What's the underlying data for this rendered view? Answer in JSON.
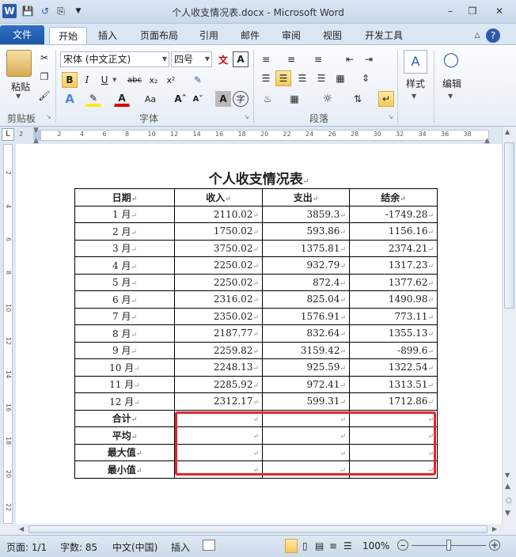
{
  "window": {
    "title": "个人收支情况表.docx - Microsoft Word"
  },
  "tabs": [
    {
      "label": "文件"
    },
    {
      "label": "开始"
    },
    {
      "label": "插入"
    },
    {
      "label": "页面布局"
    },
    {
      "label": "引用"
    },
    {
      "label": "邮件"
    },
    {
      "label": "审阅"
    },
    {
      "label": "视图"
    },
    {
      "label": "开发工具"
    }
  ],
  "ribbon": {
    "clipboard": {
      "label": "剪贴板",
      "paste": "粘贴"
    },
    "font": {
      "label": "字体",
      "font_name": "宋体 (中文正文)",
      "font_size": "四号"
    },
    "paragraph": {
      "label": "段落"
    },
    "styles": {
      "label": "样式"
    },
    "editing": {
      "label": "编辑"
    }
  },
  "ruler": {
    "ticks": [
      "2",
      "2",
      "4",
      "6",
      "8",
      "10",
      "12",
      "14",
      "16",
      "18",
      "20",
      "22",
      "24",
      "26",
      "28",
      "30",
      "32",
      "34",
      "36",
      "38"
    ]
  },
  "vruler": {
    "ticks": [
      "2",
      "4",
      "6",
      "8",
      "10",
      "12",
      "14",
      "16",
      "18",
      "20",
      "22"
    ]
  },
  "document": {
    "title": "个人收支情况表",
    "table": {
      "headers": [
        "日期",
        "收入",
        "支出",
        "结余"
      ],
      "rows": [
        [
          "1 月",
          "2110.02",
          "3859.3",
          "-1749.28"
        ],
        [
          "2 月",
          "1750.02",
          "593.86",
          "1156.16"
        ],
        [
          "3 月",
          "3750.02",
          "1375.81",
          "2374.21"
        ],
        [
          "4 月",
          "2250.02",
          "932.79",
          "1317.23"
        ],
        [
          "5 月",
          "2250.02",
          "872.4",
          "1377.62"
        ],
        [
          "6 月",
          "2316.02",
          "825.04",
          "1490.98"
        ],
        [
          "7 月",
          "2350.02",
          "1576.91",
          "773.11"
        ],
        [
          "8 月",
          "2187.77",
          "832.64",
          "1355.13"
        ],
        [
          "9 月",
          "2259.82",
          "3159.42",
          "-899.6"
        ],
        [
          "10 月",
          "2248.13",
          "925.59",
          "1322.54"
        ],
        [
          "11 月",
          "2285.92",
          "972.41",
          "1313.51"
        ],
        [
          "12 月",
          "2312.17",
          "599.31",
          "1712.86"
        ]
      ],
      "summary": [
        "合计",
        "平均",
        "最大值",
        "最小值"
      ]
    }
  },
  "statusbar": {
    "page": "页面: 1/1",
    "words": "字数: 85",
    "language": "中文(中国)",
    "mode": "插入",
    "zoom": "100%"
  },
  "colors": {
    "accent": "#1b55a6",
    "highlight": "#e0262f"
  }
}
